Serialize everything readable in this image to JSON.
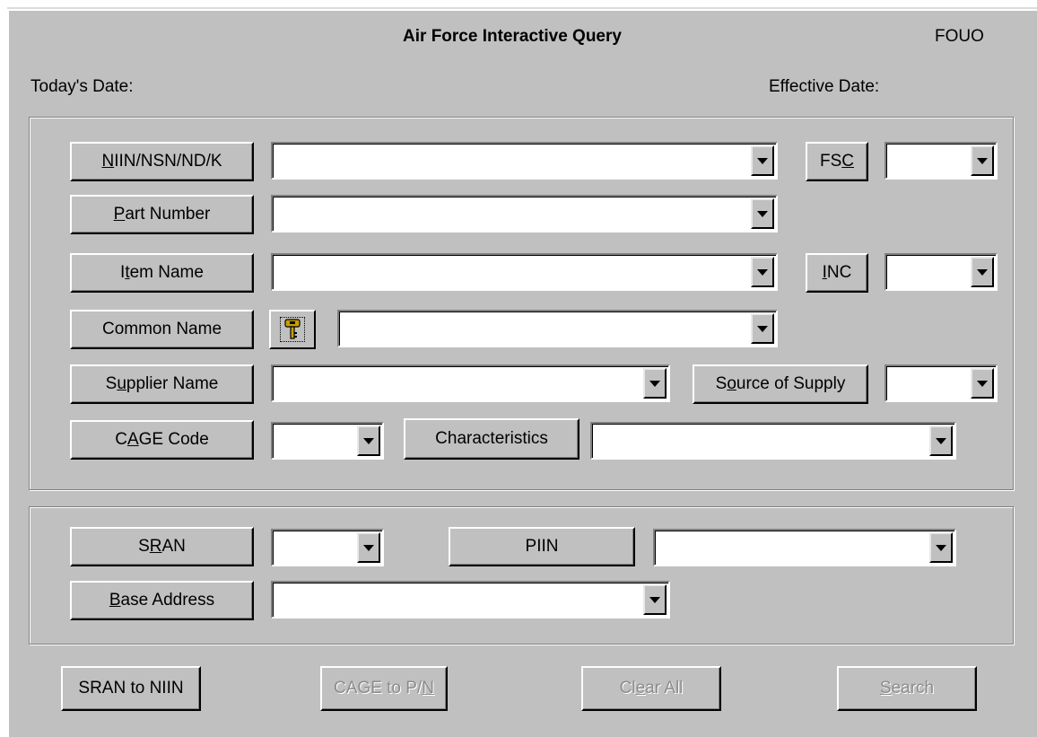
{
  "window": {
    "title": "Air Force Interactive Query",
    "classification": "FOUO",
    "todays_date_label": "Today's Date:",
    "effective_date_label": "Effective Date:"
  },
  "query_group": {
    "niin_button": {
      "mnemonic": "N",
      "rest": "IIN/NSN/ND/K"
    },
    "fsc_button": {
      "before": "FS",
      "mnemonic": "C",
      "after": ""
    },
    "part_number_button": {
      "mnemonic": "P",
      "rest": "art Number"
    },
    "item_name_button": {
      "before": "I",
      "mnemonic": "t",
      "after": "em Name"
    },
    "inc_button": {
      "mnemonic": "I",
      "rest": "NC"
    },
    "common_name_button": "Common Name",
    "supplier_name_button": {
      "before": "S",
      "mnemonic": "u",
      "after": "pplier Name"
    },
    "source_of_supply_button": {
      "before": "S",
      "mnemonic": "o",
      "after": "urce of Supply"
    },
    "cage_code_button": {
      "before": "C",
      "mnemonic": "A",
      "after": "GE Code"
    },
    "characteristics_button": "Characteristics",
    "niin_value": "",
    "fsc_value": "",
    "part_number_value": "",
    "item_name_value": "",
    "inc_value": "",
    "common_name_value": "",
    "supplier_name_value": "",
    "source_of_supply_value": "",
    "cage_code_value": "",
    "characteristics_value": ""
  },
  "base_group": {
    "sran_button": {
      "before": "S",
      "mnemonic": "R",
      "after": "AN"
    },
    "piin_button": "PIIN",
    "base_address_button": {
      "mnemonic": "B",
      "rest": "ase Address"
    },
    "sran_value": "",
    "piin_value": "",
    "base_address_value": ""
  },
  "actions": {
    "sran_to_niin": "SRAN to NIIN",
    "cage_to_pn": {
      "before": "CAGE to P/",
      "mnemonic": "N",
      "after": ""
    },
    "clear_all": {
      "before": "Cl",
      "mnemonic": "e",
      "after": "ar All"
    },
    "search": {
      "mnemonic": "S",
      "rest": "earch"
    }
  },
  "icons": {
    "key": "key-icon",
    "dropdown": "chevron-down-icon"
  },
  "colors": {
    "face": "#c0c0c0",
    "disabled_text": "#8c8c8c",
    "field": "#ffffff"
  }
}
